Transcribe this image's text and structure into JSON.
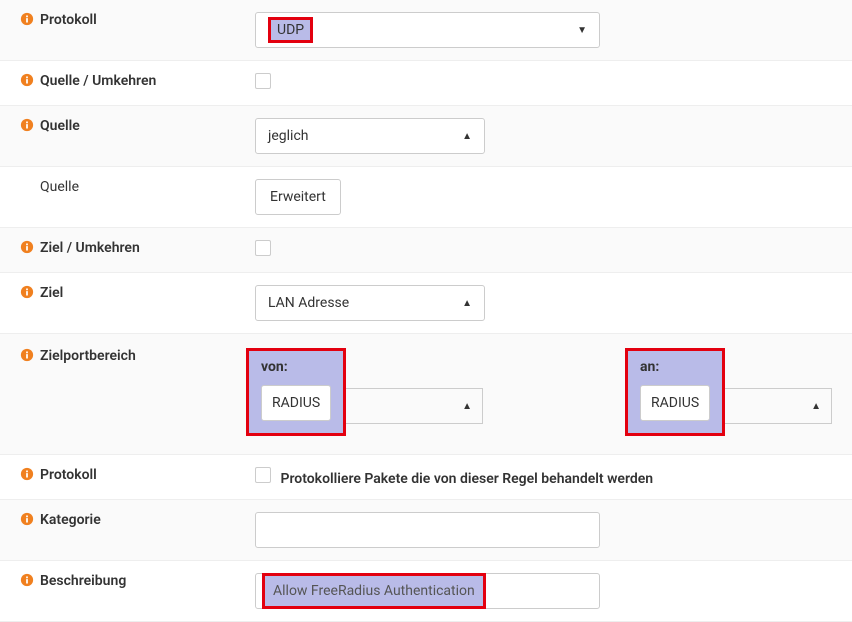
{
  "rows": {
    "protokoll": {
      "label": "Protokoll",
      "value": "UDP"
    },
    "quelleUmkehren": {
      "label": "Quelle / Umkehren",
      "checked": false
    },
    "quelle": {
      "label": "Quelle",
      "value": "jeglich"
    },
    "quelleAdv": {
      "label": "Quelle",
      "button": "Erweitert"
    },
    "zielUmkehren": {
      "label": "Ziel / Umkehren",
      "checked": false
    },
    "ziel": {
      "label": "Ziel",
      "value": "LAN Adresse"
    },
    "zielportbereich": {
      "label": "Zielportbereich",
      "von": {
        "label": "von:",
        "value": "RADIUS"
      },
      "an": {
        "label": "an:",
        "value": "RADIUS"
      }
    },
    "protokoll2": {
      "label": "Protokoll",
      "checkboxLabel": "Protokolliere Pakete die von dieser Regel behandelt werden",
      "checked": false
    },
    "kategorie": {
      "label": "Kategorie",
      "value": ""
    },
    "beschreibung": {
      "label": "Beschreibung",
      "value": "Allow FreeRadius Authentication"
    }
  }
}
